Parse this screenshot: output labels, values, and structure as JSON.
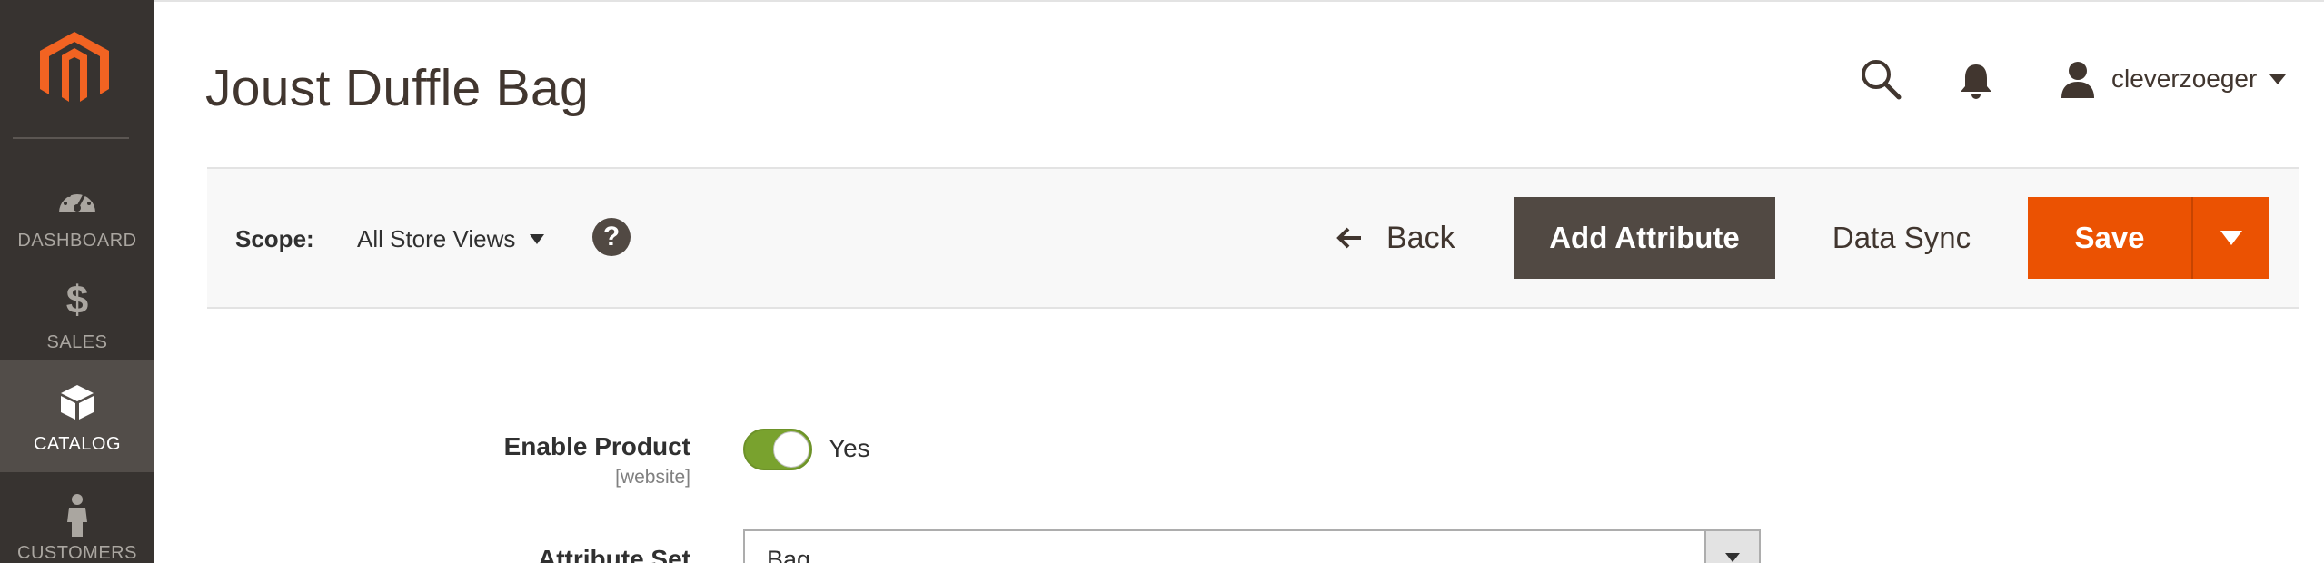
{
  "sidebar": {
    "logo": "magento-logo",
    "items": [
      {
        "label": "DASHBOARD",
        "icon": "dashboard-icon",
        "active": false
      },
      {
        "label": "SALES",
        "icon": "dollar-icon",
        "active": false
      },
      {
        "label": "CATALOG",
        "icon": "box-icon",
        "active": true
      },
      {
        "label": "CUSTOMERS",
        "icon": "person-icon",
        "active": false
      }
    ]
  },
  "header": {
    "title": "Joust Duffle Bag",
    "user": {
      "name": "cleverzoeger"
    }
  },
  "toolbar": {
    "scope_label": "Scope:",
    "scope_value": "All Store Views",
    "help_glyph": "?",
    "back_label": "Back",
    "add_attribute_label": "Add Attribute",
    "data_sync_label": "Data Sync",
    "save_label": "Save"
  },
  "form": {
    "enable_product": {
      "label": "Enable Product",
      "scope": "[website]",
      "value": "Yes",
      "on": true
    },
    "attribute_set": {
      "label": "Attribute Set",
      "value": "Bag"
    }
  },
  "colors": {
    "sidebar_bg": "#373330",
    "sidebar_active": "#524d49",
    "brand_orange": "#eb5202",
    "dark_button": "#514943",
    "toggle_green": "#79a22e"
  }
}
